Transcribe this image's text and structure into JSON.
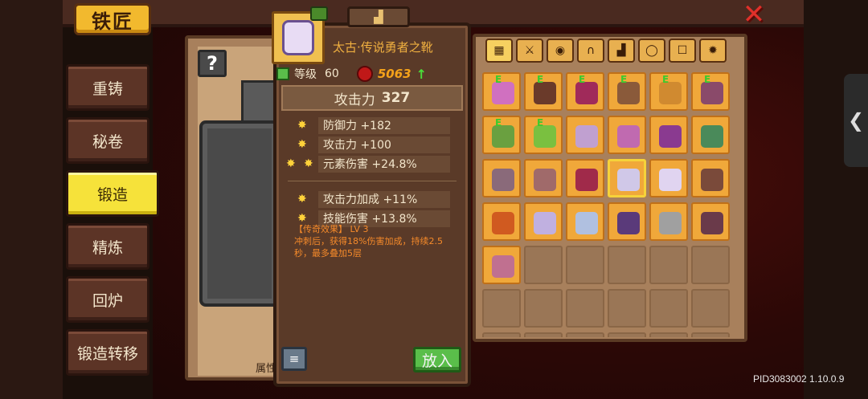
{
  "header": {
    "title": "铁匠",
    "close_icon": "close-icon"
  },
  "sidebar": {
    "items": [
      {
        "label": "重铸",
        "active": false
      },
      {
        "label": "秘卷",
        "active": false
      },
      {
        "label": "锻造",
        "active": true
      },
      {
        "label": "精炼",
        "active": false
      },
      {
        "label": "回炉",
        "active": false
      },
      {
        "label": "锻造转移",
        "active": false
      }
    ]
  },
  "forge": {
    "help_label": "?",
    "attr_stub": "属性"
  },
  "item": {
    "name": "太古·传说勇者之靴",
    "level_label": "等级",
    "level": "60",
    "power": "5063",
    "attack_label": "攻击力",
    "attack_value": "327",
    "stats": [
      {
        "stars": 1,
        "text": "防御力 +182"
      },
      {
        "stars": 1,
        "text": "攻击力 +100"
      },
      {
        "stars": 2,
        "text": "元素伤害 +24.8%"
      }
    ],
    "extra_stats": [
      {
        "stars": 1,
        "text": "攻击力加成 +11%"
      },
      {
        "stars": 1,
        "text": "技能伤害 +13.8%"
      }
    ],
    "legend_head": "【传奇效果】 LV 3",
    "legend_body": "冲刺后，获得18%伤害加成，持续2.5秒，最多叠加5层"
  },
  "buttons": {
    "list_icon": "≡",
    "put_in": "放入"
  },
  "inventory": {
    "tabs": [
      "▦",
      "⚔",
      "◉",
      "∩",
      "▟",
      "◯",
      "☐",
      "✹"
    ],
    "slots": [
      {
        "filled": true,
        "e": true,
        "color": "#d070c0"
      },
      {
        "filled": true,
        "e": true,
        "color": "#6a3a2a"
      },
      {
        "filled": true,
        "e": true,
        "color": "#a02a5a"
      },
      {
        "filled": true,
        "e": true,
        "color": "#8a5a3a"
      },
      {
        "filled": true,
        "e": true,
        "color": "#d08a30"
      },
      {
        "filled": true,
        "e": true,
        "color": "#8a4a6a"
      },
      {
        "filled": true,
        "e": true,
        "color": "#6aa040"
      },
      {
        "filled": true,
        "e": true,
        "color": "#7ac040"
      },
      {
        "filled": true,
        "e": false,
        "color": "#c0a0d0"
      },
      {
        "filled": true,
        "e": false,
        "color": "#c06ab0"
      },
      {
        "filled": true,
        "e": false,
        "color": "#8a3a90"
      },
      {
        "filled": true,
        "e": false,
        "color": "#4a8a5a"
      },
      {
        "filled": true,
        "e": false,
        "color": "#8a6a7a"
      },
      {
        "filled": true,
        "e": false,
        "color": "#a06a6a"
      },
      {
        "filled": true,
        "e": false,
        "color": "#a02a4a"
      },
      {
        "filled": true,
        "e": false,
        "color": "#d0c8e8",
        "selected": true
      },
      {
        "filled": true,
        "e": false,
        "color": "#e0d4f0"
      },
      {
        "filled": true,
        "e": false,
        "color": "#7a4a3a"
      },
      {
        "filled": true,
        "e": false,
        "color": "#d05a20"
      },
      {
        "filled": true,
        "e": false,
        "color": "#c0b0e0"
      },
      {
        "filled": true,
        "e": false,
        "color": "#b0c0e0"
      },
      {
        "filled": true,
        "e": false,
        "color": "#5a3a7a"
      },
      {
        "filled": true,
        "e": false,
        "color": "#a0a0a0"
      },
      {
        "filled": true,
        "e": false,
        "color": "#6a3a4a"
      },
      {
        "filled": true,
        "e": false,
        "color": "#c07090"
      },
      {
        "filled": false
      },
      {
        "filled": false
      },
      {
        "filled": false
      },
      {
        "filled": false
      },
      {
        "filled": false
      },
      {
        "filled": false
      },
      {
        "filled": false
      },
      {
        "filled": false
      },
      {
        "filled": false
      },
      {
        "filled": false
      },
      {
        "filled": false
      },
      {
        "filled": false
      },
      {
        "filled": false
      },
      {
        "filled": false
      },
      {
        "filled": false
      },
      {
        "filled": false
      },
      {
        "filled": false
      },
      {
        "filled": false
      },
      {
        "filled": false
      },
      {
        "filled": false
      },
      {
        "filled": false
      },
      {
        "filled": false
      },
      {
        "filled": false
      }
    ]
  },
  "side_arrow": "❮",
  "footer": {
    "pid": "PID3083002 1.10.0.9"
  }
}
